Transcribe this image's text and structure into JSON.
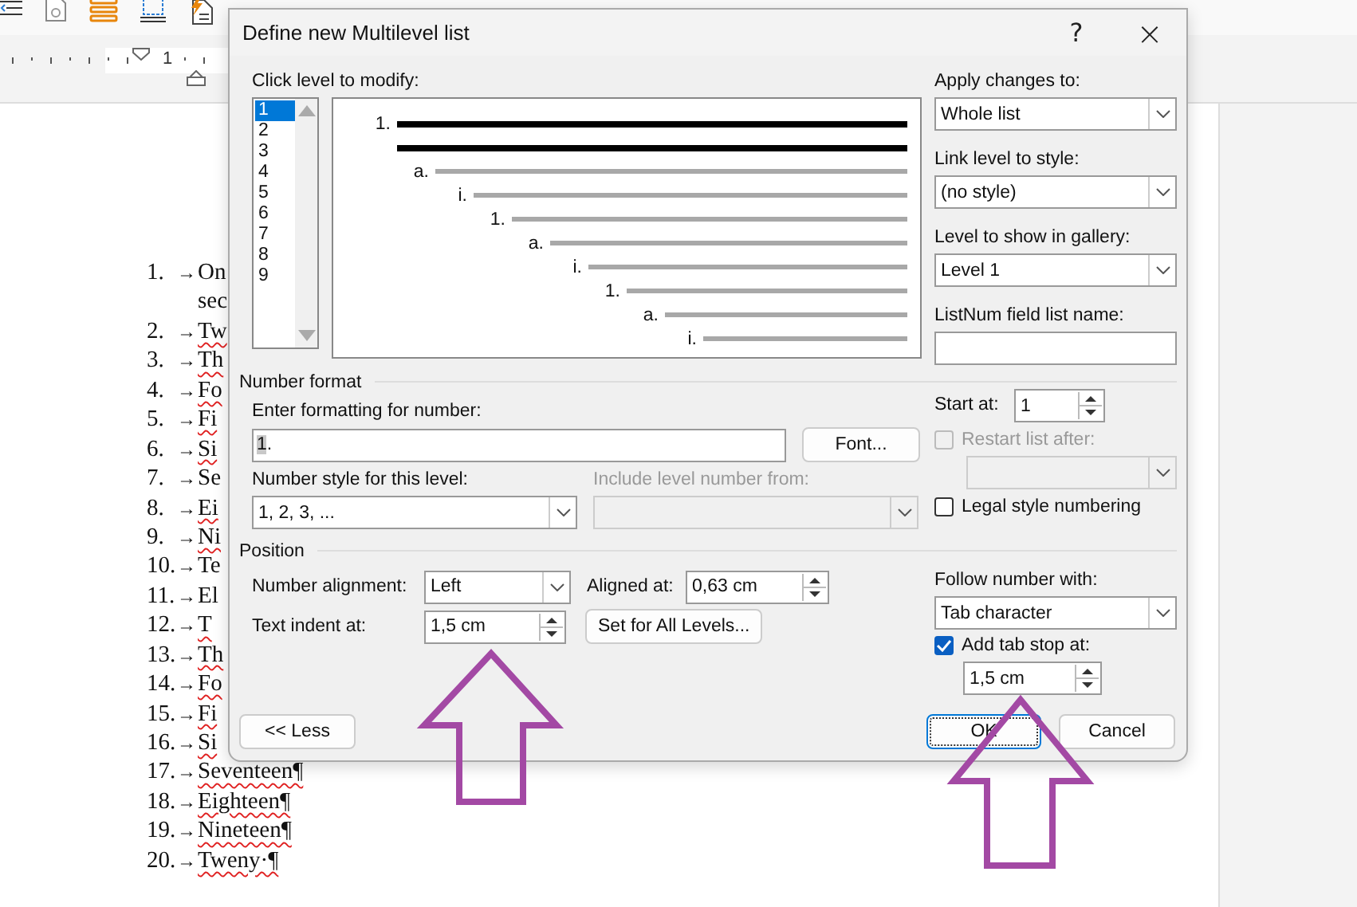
{
  "ruler": {
    "labels": [
      "1"
    ]
  },
  "document": {
    "items": [
      {
        "number": "1.",
        "tab": "→",
        "lines": [
          "On",
          "sec"
        ],
        "misspelled": false
      },
      {
        "number": "2.",
        "tab": "→",
        "lines": [
          "Tw"
        ],
        "misspelled": true
      },
      {
        "number": "3.",
        "tab": "→",
        "lines": [
          "Th"
        ],
        "misspelled": true
      },
      {
        "number": "4.",
        "tab": "→",
        "lines": [
          "Fo"
        ],
        "misspelled": true
      },
      {
        "number": "5.",
        "tab": "→",
        "lines": [
          "Fi"
        ],
        "misspelled": true
      },
      {
        "number": "6.",
        "tab": "→",
        "lines": [
          "Si"
        ],
        "misspelled": true
      },
      {
        "number": "7.",
        "tab": "→",
        "lines": [
          "Se"
        ],
        "misspelled": false
      },
      {
        "number": "8.",
        "tab": "→",
        "lines": [
          "Ei"
        ],
        "misspelled": true
      },
      {
        "number": "9.",
        "tab": "→",
        "lines": [
          "Ni"
        ],
        "misspelled": true
      },
      {
        "number": "10.",
        "tab": "→",
        "lines": [
          "Te"
        ],
        "misspelled": false
      },
      {
        "number": "11.",
        "tab": "→",
        "lines": [
          "El"
        ],
        "misspelled": false
      },
      {
        "number": "12.",
        "tab": "→",
        "lines": [
          "T"
        ],
        "misspelled": true
      },
      {
        "number": "13.",
        "tab": "→",
        "lines": [
          "Th"
        ],
        "misspelled": true
      },
      {
        "number": "14.",
        "tab": "→",
        "lines": [
          "Fo"
        ],
        "misspelled": true
      },
      {
        "number": "15.",
        "tab": "→",
        "lines": [
          "Fi"
        ],
        "misspelled": true
      },
      {
        "number": "16.",
        "tab": "→",
        "lines": [
          "Si"
        ],
        "misspelled": true
      },
      {
        "number": "17.",
        "tab": "→",
        "lines": [
          "Seventeen¶"
        ],
        "misspelled": true
      },
      {
        "number": "18.",
        "tab": "→",
        "lines": [
          "Eighteen¶"
        ],
        "misspelled": true
      },
      {
        "number": "19.",
        "tab": "→",
        "lines": [
          "Nineteen¶"
        ],
        "misspelled": true
      },
      {
        "number": "20.",
        "tab": "→",
        "lines": [
          "Tweny·¶"
        ],
        "misspelled": true
      }
    ]
  },
  "dialog": {
    "title": "Define new Multilevel list",
    "help": "?",
    "close": "×",
    "level_picker": {
      "label": "Click level to modify:",
      "levels": [
        {
          "label": "1",
          "selected": true
        },
        {
          "label": "2",
          "selected": false
        },
        {
          "label": "3",
          "selected": false
        },
        {
          "label": "4",
          "selected": false
        },
        {
          "label": "5",
          "selected": false
        },
        {
          "label": "6",
          "selected": false
        },
        {
          "label": "7",
          "selected": false
        },
        {
          "label": "8",
          "selected": false
        },
        {
          "label": "9",
          "selected": false
        }
      ]
    },
    "preview": {
      "levels": [
        {
          "label": "1.",
          "selected": true
        },
        {
          "label": "a.",
          "selected": false
        },
        {
          "label": "i.",
          "selected": false
        },
        {
          "label": "1.",
          "selected": false
        },
        {
          "label": "a.",
          "selected": false
        },
        {
          "label": "i.",
          "selected": false
        },
        {
          "label": "1.",
          "selected": false
        },
        {
          "label": "a.",
          "selected": false
        },
        {
          "label": "i.",
          "selected": false
        }
      ]
    },
    "apply_changes": {
      "label": "Apply changes to:",
      "value": "Whole list"
    },
    "link_level": {
      "label": "Link level to style:",
      "value": "(no style)"
    },
    "gallery_level": {
      "label": "Level to show in gallery:",
      "value": "Level 1"
    },
    "listnum": {
      "label": "ListNum field list name:"
    },
    "number_format": {
      "heading": "Number format",
      "format_label": "Enter formatting for number:",
      "format_parts": [
        {
          "text": "1",
          "kind": "level_number"
        },
        {
          "text": ".",
          "kind": "literal"
        }
      ],
      "font_button": "Font...",
      "style_label": "Number style for this level:",
      "style_value": "1, 2, 3, ...",
      "include_label": "Include level number from:",
      "include_disabled": true,
      "start_label": "Start at:",
      "start_value": "1",
      "restart": {
        "label": "Restart list after:",
        "checked": false,
        "disabled": true
      },
      "legal": {
        "label": "Legal style numbering",
        "checked": false
      }
    },
    "position": {
      "heading": "Position",
      "alignment_label": "Number alignment:",
      "alignment_value": "Left",
      "aligned_label": "Aligned at:",
      "aligned_value": "0,63 cm",
      "indent_label": "Text indent at:",
      "indent_value": "1,5 cm",
      "set_all_button": "Set for All Levels...",
      "follow_label": "Follow number with:",
      "follow_value": "Tab character",
      "tab_stop": {
        "label": "Add tab stop at:",
        "checked": true
      },
      "tab_stop_value": "1,5 cm"
    },
    "buttons": {
      "less": "<< Less",
      "ok": "OK",
      "cancel": "Cancel"
    }
  }
}
